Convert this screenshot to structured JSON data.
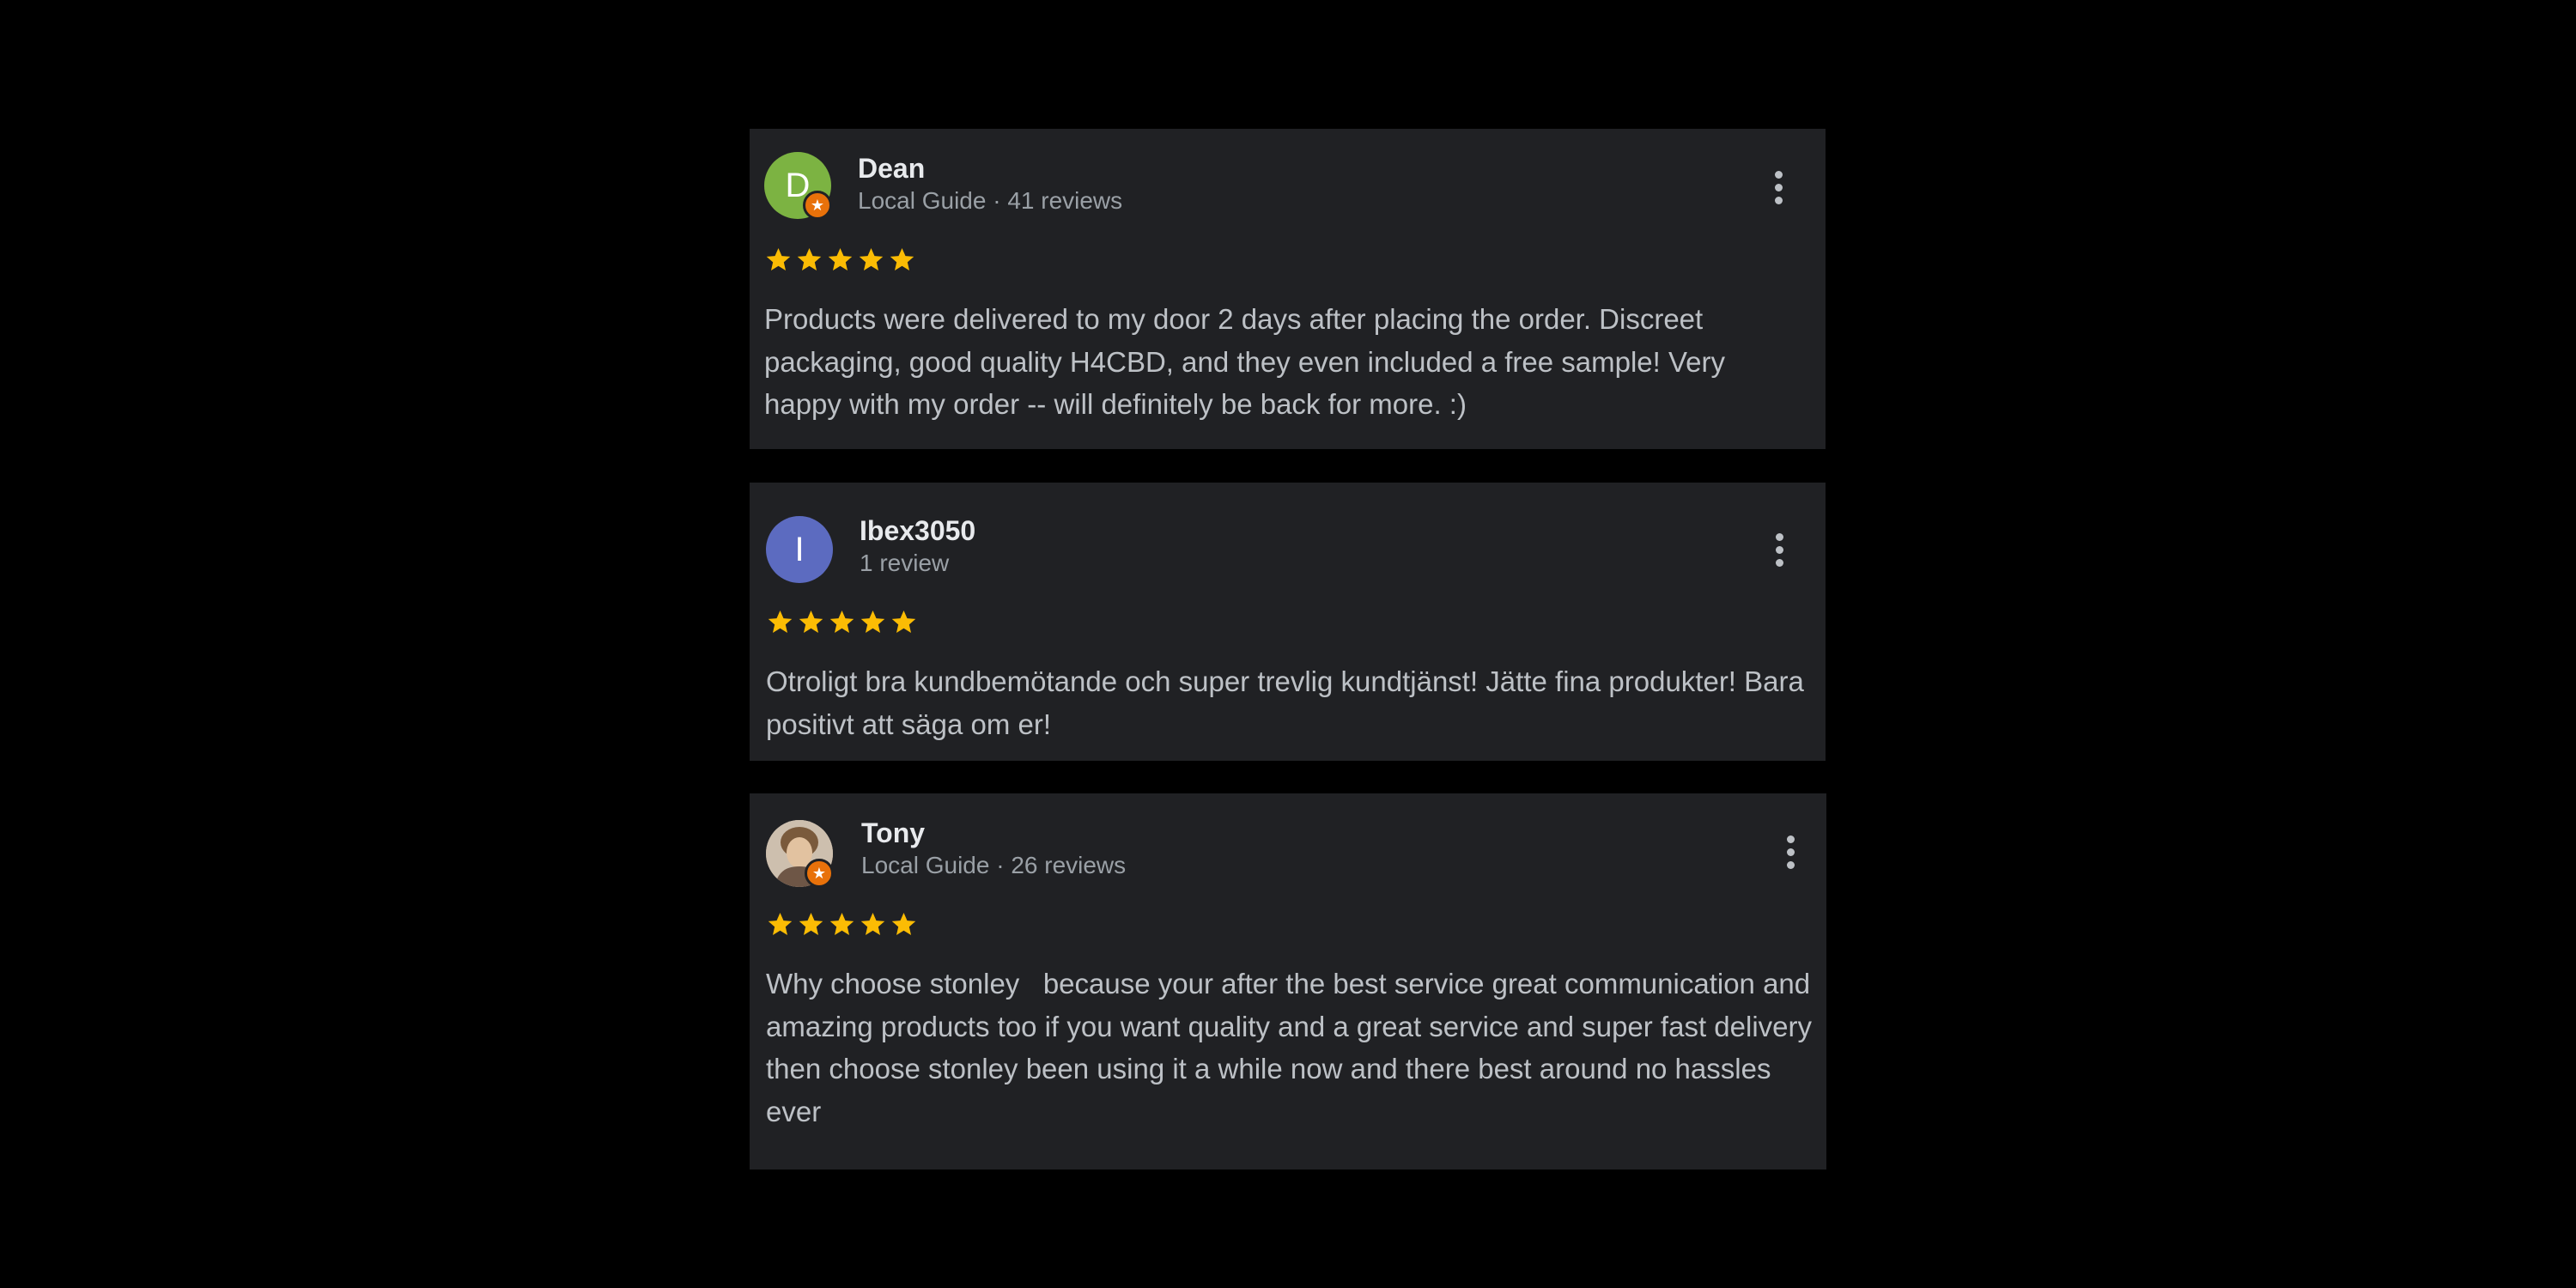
{
  "colors": {
    "page_background": "#000000",
    "card_background": "#202124",
    "star": "#fbbc04",
    "guide_badge": "#e8710a",
    "name_text": "#e8eaed",
    "meta_text": "#9aa0a6",
    "body_text": "#bdc1c6"
  },
  "reviews": [
    {
      "avatar_letter": "D",
      "avatar_color": "#7cb342",
      "local_guide": true,
      "name": "Dean",
      "meta": "Local Guide · 41 reviews",
      "rating": 5,
      "rating_max": 5,
      "text": "Products were delivered to my door 2 days after placing the order. Discreet packaging, good quality H4CBD, and they even included a free sample! Very happy with my order -- will definitely be back for more. :)",
      "menu_icon": "more-vert-icon"
    },
    {
      "avatar_letter": "I",
      "avatar_color": "#5c6bc0",
      "local_guide": false,
      "name": "Ibex3050",
      "meta": "1 review",
      "rating": 5,
      "rating_max": 5,
      "text": "Otroligt bra kundbemötande och super trevlig kundtjänst! Jätte fina produkter! Bara positivt att säga om er!",
      "menu_icon": "more-vert-icon"
    },
    {
      "avatar_letter": "",
      "avatar_color": "",
      "local_guide": true,
      "name": "Tony",
      "meta": "Local Guide · 26 reviews",
      "rating": 5,
      "rating_max": 5,
      "text": "Why choose stonley   because your after the best service great communication and amazing products too if you want quality and a great service and super fast delivery then choose stonley been using it a while now and there best around no hassles ever",
      "menu_icon": "more-vert-icon"
    }
  ],
  "badge_icon": "star-icon"
}
